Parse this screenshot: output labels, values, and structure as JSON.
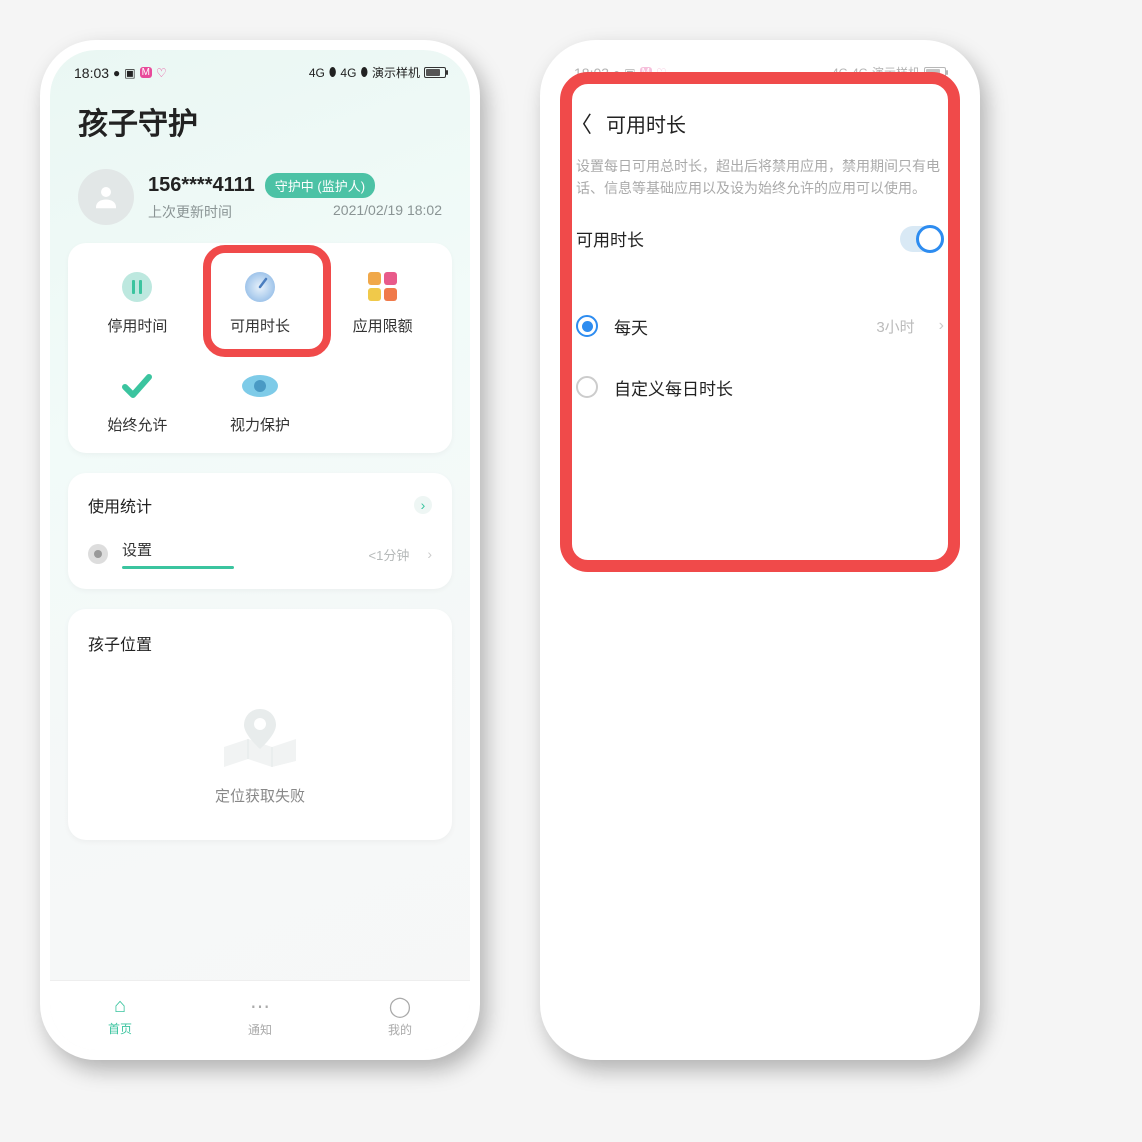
{
  "status": {
    "time": "18:03",
    "carrier_label": "演示样机",
    "signal1": "4G",
    "signal2": "4G",
    "battery_text": "77"
  },
  "left": {
    "page_title": "孩子守护",
    "phone_number": "156****4111",
    "status_badge": "守护中 (监护人)",
    "last_update_label": "上次更新时间",
    "last_update_value": "2021/02/19 18:02",
    "features": {
      "pause": "停用时间",
      "available": "可用时长",
      "quota": "应用限额",
      "allow": "始终允许",
      "vision": "视力保护"
    },
    "stats": {
      "title": "使用统计",
      "item_name": "设置",
      "item_time": "<1分钟"
    },
    "location": {
      "title": "孩子位置",
      "fail_text": "定位获取失败"
    },
    "nav": {
      "home": "首页",
      "notify": "通知",
      "mine": "我的"
    }
  },
  "right": {
    "title": "可用时长",
    "description": "设置每日可用总时长，超出后将禁用应用，禁用期间只有电话、信息等基础应用以及设为始终允许的应用可以使用。",
    "toggle_label": "可用时长",
    "option_daily": "每天",
    "option_daily_value": "3小时",
    "option_custom": "自定义每日时长"
  }
}
